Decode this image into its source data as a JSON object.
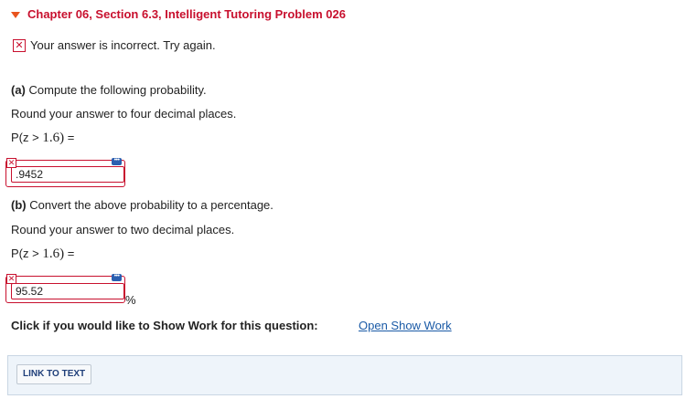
{
  "header": {
    "title": "Chapter 06, Section 6.3, Intelligent Tutoring Problem 026"
  },
  "status": {
    "message": "Your answer is incorrect.  Try again."
  },
  "part_a": {
    "label": "(a)",
    "prompt": " Compute the following probability.",
    "instruction": "Round your answer to four decimal places.",
    "expr_prefix": "P(z > ",
    "expr_math": "1.6)",
    "expr_suffix": " =",
    "answer": ".9452"
  },
  "part_b": {
    "label": "(b)",
    "prompt": " Convert the above probability to a percentage.",
    "instruction": "Round your answer to two decimal places.",
    "expr_prefix": "P(z > ",
    "expr_math": "1.6)",
    "expr_suffix": " =",
    "answer": "95.52",
    "unit": "%"
  },
  "show_work": {
    "prompt": "Click if you would like to Show Work for this question:",
    "link": "Open Show Work"
  },
  "bottom": {
    "link_button": "LINK TO TEXT"
  },
  "icons": {
    "incorrect": "✕",
    "field_error": "✕",
    "field_menu": "•••"
  },
  "colors": {
    "error_red": "#c8102e",
    "link_blue": "#1a5aa6",
    "accent_orange": "#e8541e"
  }
}
